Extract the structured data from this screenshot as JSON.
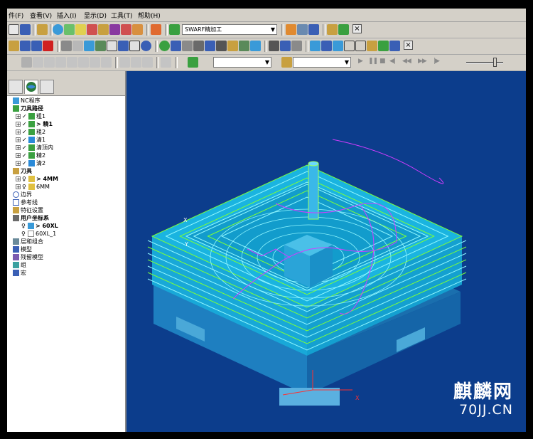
{
  "menu": {
    "items": [
      "件(F)",
      "查看(V)",
      "插入(I)",
      "显示(D)",
      "工具(T)",
      "帮助(H)"
    ]
  },
  "toolbar": {
    "toolpath_combo": "SWARF精加工",
    "close_label": "×"
  },
  "explorer": {
    "tree": {
      "nc_program": "NC程序",
      "toolpaths": "刀具路径",
      "toolpath_items": [
        "粗1",
        "> 精1",
        "粗2",
        "清1",
        "清顶内",
        "精2",
        "清2"
      ],
      "tools": "刀具",
      "tool_items": [
        "> 4MM",
        "6MM"
      ],
      "boundary": "边界",
      "reference_line": "参考线",
      "feature_settings": "特征设置",
      "user_coord": "用户坐标系",
      "coord_items": [
        "> 60XL",
        "60XL_1"
      ],
      "layers": "层和组合",
      "model": "模型",
      "residual_model": "残留模型",
      "group": "组",
      "macro": "宏"
    }
  },
  "viewport": {
    "axis_labels": [
      "X",
      "Y",
      "X"
    ],
    "watermark_main": "麒麟网",
    "watermark_url": "70JJ.CN"
  },
  "colors": {
    "viewport_bg": "#0c3d8c",
    "model_top": "#17a8d4",
    "model_side": "#1a6fae",
    "toolpath_green": "#7cff3a",
    "toolpath_cyan": "#8ff6ff",
    "toolpath_magenta": "#d23cff"
  }
}
